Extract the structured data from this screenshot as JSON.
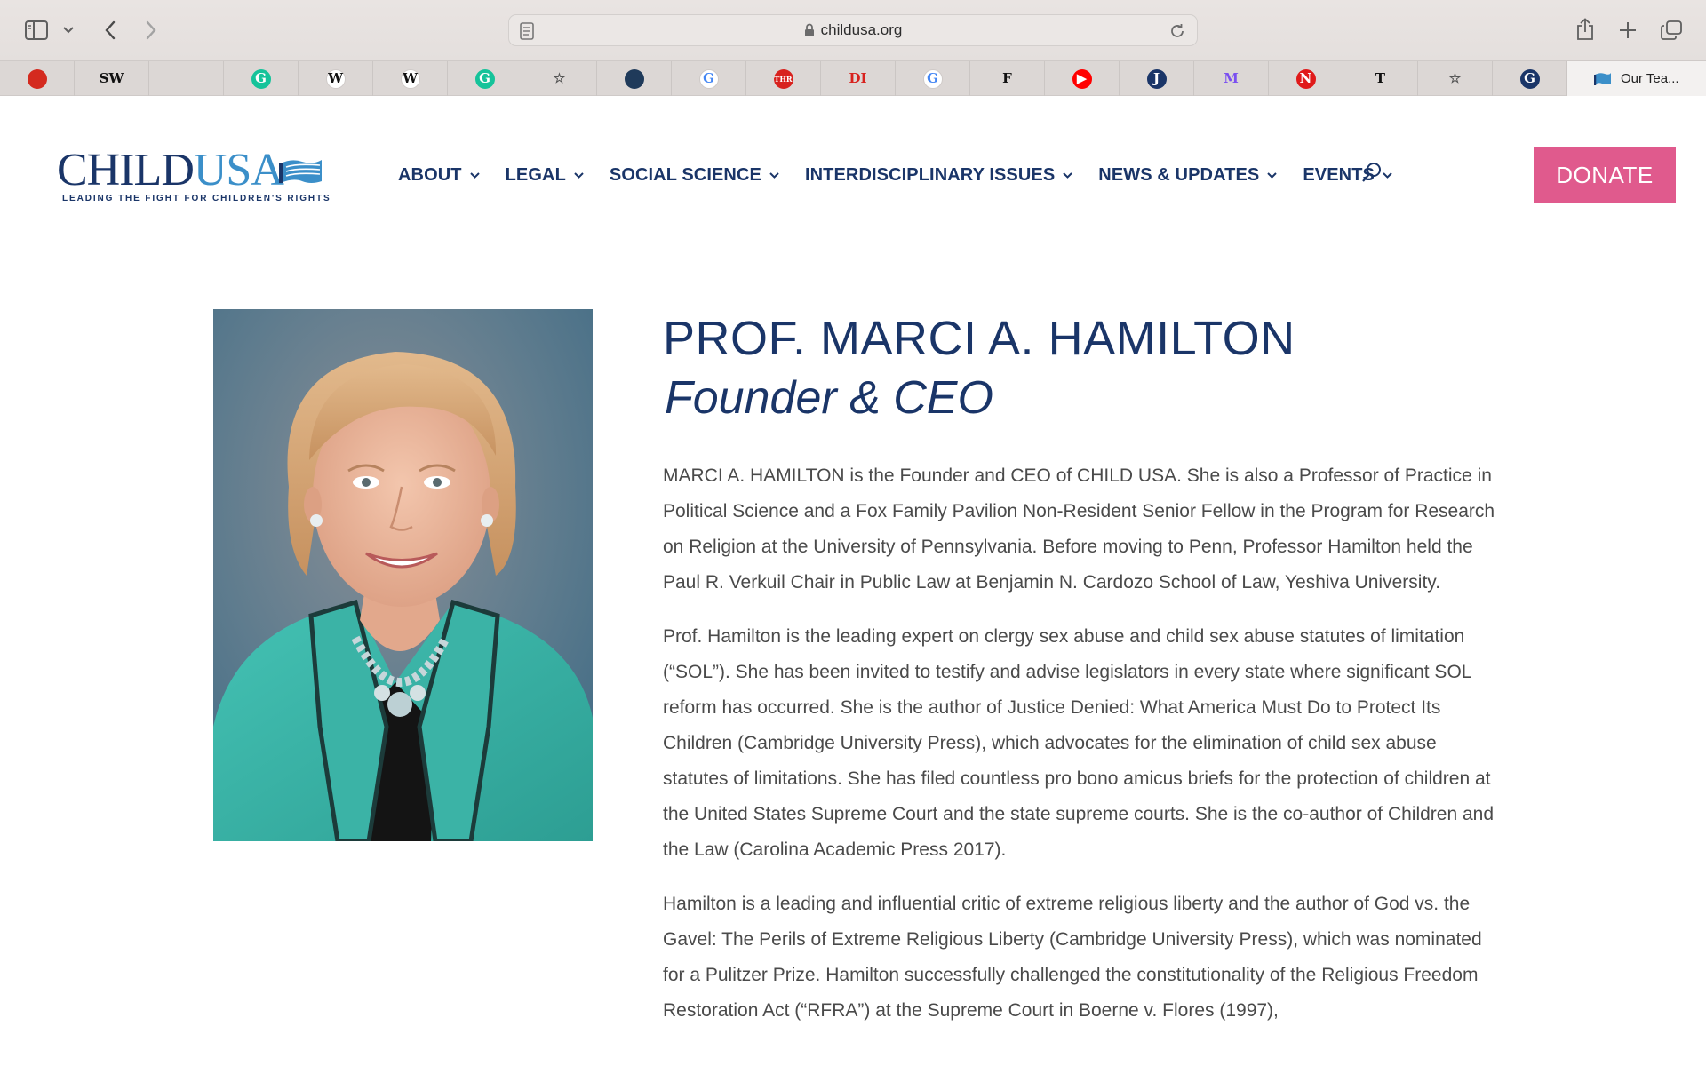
{
  "browser": {
    "url": "childusa.org",
    "active_tab_title": "Our Tea...",
    "favorites": [
      {
        "icon": "red-square-icon",
        "glyph": "",
        "bg": "#d42a1f",
        "fg": "#ffffff"
      },
      {
        "icon": "sw-logo-icon",
        "glyph": "SW",
        "bg": "transparent",
        "fg": "#111111"
      },
      {
        "icon": "rainbow-icon",
        "glyph": "",
        "bg": "transparent",
        "fg": "#b5683a"
      },
      {
        "icon": "grammarly-icon",
        "glyph": "G",
        "bg": "#15c39a",
        "fg": "#ffffff"
      },
      {
        "icon": "wikipedia-icon",
        "glyph": "W",
        "bg": "#ffffff",
        "fg": "#111111"
      },
      {
        "icon": "wikipedia-icon",
        "glyph": "W",
        "bg": "#ffffff",
        "fg": "#111111"
      },
      {
        "icon": "grammarly-icon",
        "glyph": "G",
        "bg": "#15c39a",
        "fg": "#ffffff"
      },
      {
        "icon": "star-icon",
        "glyph": "☆",
        "bg": "transparent",
        "fg": "#555555"
      },
      {
        "icon": "landscape-icon",
        "glyph": "",
        "bg": "#1f3a5a",
        "fg": "#ffffff"
      },
      {
        "icon": "google-icon",
        "glyph": "G",
        "bg": "#ffffff",
        "fg": "#4285f4"
      },
      {
        "icon": "thr-icon",
        "glyph": "THR",
        "bg": "#d8221e",
        "fg": "#ffffff"
      },
      {
        "icon": "di-icon",
        "glyph": "DI",
        "bg": "transparent",
        "fg": "#d8221e"
      },
      {
        "icon": "google-icon",
        "glyph": "G",
        "bg": "#ffffff",
        "fg": "#4285f4"
      },
      {
        "icon": "f-logo-icon",
        "glyph": "F",
        "bg": "transparent",
        "fg": "#111111"
      },
      {
        "icon": "youtube-icon",
        "glyph": "▶",
        "bg": "#ff0000",
        "fg": "#ffffff"
      },
      {
        "icon": "j-logo-icon",
        "glyph": "J",
        "bg": "#1a3568",
        "fg": "#ffffff"
      },
      {
        "icon": "m-logo-icon",
        "glyph": "M",
        "bg": "transparent",
        "fg": "#7b4ff0"
      },
      {
        "icon": "n-logo-icon",
        "glyph": "N",
        "bg": "#e01a1a",
        "fg": "#ffffff"
      },
      {
        "icon": "nyt-icon",
        "glyph": "T",
        "bg": "transparent",
        "fg": "#111111"
      },
      {
        "icon": "star-icon",
        "glyph": "☆",
        "bg": "transparent",
        "fg": "#555555"
      },
      {
        "icon": "globe-logo-icon",
        "glyph": "G",
        "bg": "#1a3568",
        "fg": "#ffffff"
      }
    ]
  },
  "site": {
    "logo": {
      "child": "CHILD",
      "usa": "USA",
      "tagline": "LEADING THE FIGHT FOR CHILDREN'S RIGHTS"
    },
    "nav": [
      {
        "label": "ABOUT"
      },
      {
        "label": "LEGAL"
      },
      {
        "label": "SOCIAL SCIENCE"
      },
      {
        "label": "INTERDISCIPLINARY ISSUES"
      },
      {
        "label": "NEWS & UPDATES"
      },
      {
        "label": "EVENTS"
      }
    ],
    "donate_label": "DONATE",
    "colors": {
      "navy": "#1a3568",
      "pink": "#e05a8d",
      "body_text": "#4a4a4a"
    }
  },
  "profile": {
    "name": "PROF. MARCI A. HAMILTON",
    "title": "Founder & CEO",
    "bio": [
      "MARCI A. HAMILTON is the Founder and CEO of CHILD USA. She is also a Professor of Practice in Political Science and a Fox Family Pavilion Non-Resident Senior Fellow in the Program for Research on Religion at the University of Pennsylvania. Before moving to Penn, Professor Hamilton held the Paul R. Verkuil Chair in Public Law at Benjamin N. Cardozo School of Law, Yeshiva University.",
      "Prof. Hamilton is the leading expert on clergy sex abuse and child sex abuse statutes of limitation (“SOL”). She has been invited to testify and advise legislators in every state where significant SOL reform has occurred. She is the author of Justice Denied: What America Must Do to Protect Its Children (Cambridge University Press), which advocates for the elimination of child sex abuse statutes of limitations. She has filed countless pro bono amicus briefs for the protection of children at the United States Supreme Court and the state supreme courts. She is the co-author of Children and the Law (Carolina Academic Press 2017).",
      "Hamilton is a leading and influential critic of extreme religious liberty and the author of God vs. the Gavel: The Perils of Extreme Religious Liberty (Cambridge University Press), which was nominated for a Pulitzer Prize. Hamilton successfully challenged the constitutionality of the Religious Freedom Restoration Act (“RFRA”) at the Supreme Court in Boerne v. Flores (1997),"
    ]
  }
}
